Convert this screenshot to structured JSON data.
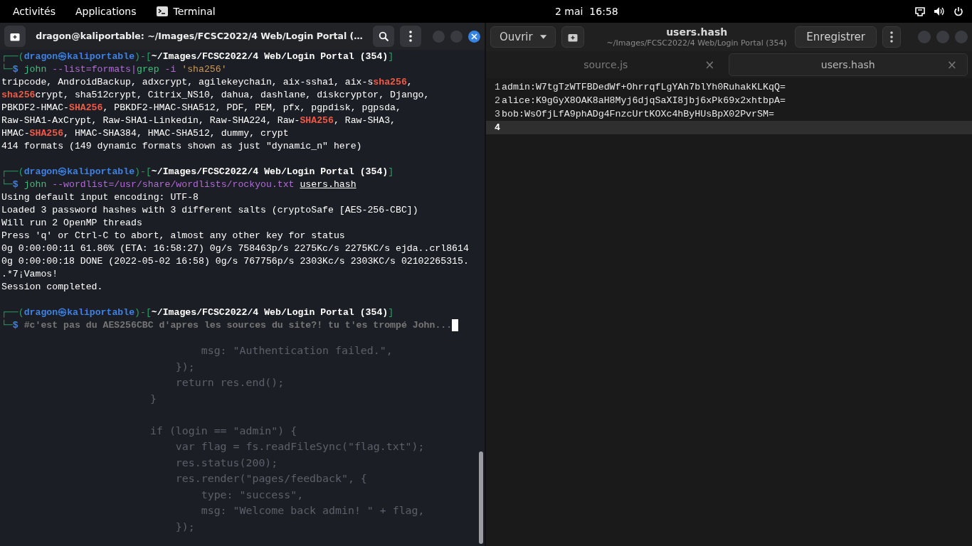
{
  "top_bar": {
    "activities": "Activités",
    "applications": "Applications",
    "app_name": "Terminal",
    "clock": "2 mai  16:58"
  },
  "terminal": {
    "title": "dragon@kaliportable: ~/Images/FCSC2022/4 Web/Login Portal (…",
    "cursor_visible": true,
    "blocks": [
      {
        "kind": "prompt",
        "frame_open": "┌──(",
        "user": "dragon㉿kaliportable",
        "frame_mid": ")-[",
        "path": "~/Images/FCSC2022/4 Web/Login Portal (354)",
        "frame_close": "]",
        "frame_bottom": "└─",
        "symbol": "$",
        "command": [
          {
            "text": "john",
            "kind": "cmd"
          },
          {
            "text": " --list=formats",
            "kind": "opt"
          },
          {
            "text": "|",
            "kind": "opt"
          },
          {
            "text": "grep",
            "kind": "cmd"
          },
          {
            "text": " -i ",
            "kind": "opt"
          },
          {
            "text": "'sha256'",
            "kind": "str"
          }
        ]
      },
      {
        "kind": "output",
        "lines": [
          [
            {
              "text": "tripcode, AndroidBackup, adxcrypt, agilekeychain, aix-ssha1, aix-s",
              "kind": "plain"
            },
            {
              "text": "sha256",
              "kind": "hl"
            },
            {
              "text": ",",
              "kind": "plain"
            }
          ],
          [
            {
              "text": "sha256",
              "kind": "hl"
            },
            {
              "text": "crypt, sha512crypt, Citrix_NS10, dahua, dashlane, diskcryptor, Django,",
              "kind": "plain"
            }
          ],
          [
            {
              "text": "PBKDF2-HMAC-",
              "kind": "plain"
            },
            {
              "text": "SHA256",
              "kind": "hl"
            },
            {
              "text": ", PBKDF2-HMAC-SHA512, PDF, PEM, pfx, pgpdisk, pgpsda,",
              "kind": "plain"
            }
          ],
          [
            {
              "text": "Raw-SHA1-AxCrypt, Raw-SHA1-Linkedin, Raw-SHA224, Raw-",
              "kind": "plain"
            },
            {
              "text": "SHA256",
              "kind": "hl"
            },
            {
              "text": ", Raw-SHA3,",
              "kind": "plain"
            }
          ],
          [
            {
              "text": "HMAC-",
              "kind": "plain"
            },
            {
              "text": "SHA256",
              "kind": "hl"
            },
            {
              "text": ", HMAC-SHA384, HMAC-SHA512, dummy, crypt",
              "kind": "plain"
            }
          ],
          [
            {
              "text": "414 formats (149 dynamic formats shown as just \"dynamic_n\" here)",
              "kind": "plain"
            }
          ]
        ]
      },
      {
        "kind": "blank"
      },
      {
        "kind": "prompt",
        "frame_open": "┌──(",
        "user": "dragon㉿kaliportable",
        "frame_mid": ")-[",
        "path": "~/Images/FCSC2022/4 Web/Login Portal (354)",
        "frame_close": "]",
        "frame_bottom": "└─",
        "symbol": "$",
        "command": [
          {
            "text": "john",
            "kind": "cmd"
          },
          {
            "text": " --wordlist=/usr/share/wordlists/rockyou.txt ",
            "kind": "opt"
          },
          {
            "text": "users.hash",
            "kind": "path"
          }
        ]
      },
      {
        "kind": "output",
        "lines": [
          [
            {
              "text": "Using default input encoding: UTF-8",
              "kind": "plain"
            }
          ],
          [
            {
              "text": "Loaded 3 password hashes with 3 different salts (cryptoSafe [AES-256-CBC])",
              "kind": "plain"
            }
          ],
          [
            {
              "text": "Will run 2 OpenMP threads",
              "kind": "plain"
            }
          ],
          [
            {
              "text": "Press 'q' or Ctrl-C to abort, almost any other key for status",
              "kind": "plain"
            }
          ],
          [
            {
              "text": "0g 0:00:00:11 61.86% (ETA: 16:58:27) 0g/s 758463p/s 2275Kc/s 2275KC/s ejda..crl8614",
              "kind": "plain"
            }
          ],
          [
            {
              "text": "0g 0:00:00:18 DONE (2022-05-02 16:58) 0g/s 767756p/s 2303Kc/s 2303KC/s 02102265315.",
              "kind": "plain"
            }
          ],
          [
            {
              "text": ".*7¡Vamos!",
              "kind": "plain"
            }
          ],
          [
            {
              "text": "Session completed.",
              "kind": "plain"
            }
          ]
        ]
      },
      {
        "kind": "blank"
      },
      {
        "kind": "prompt",
        "frame_open": "┌──(",
        "user": "dragon㉿kaliportable",
        "frame_mid": ")-[",
        "path": "~/Images/FCSC2022/4 Web/Login Portal (354)",
        "frame_close": "]",
        "frame_bottom": "└─",
        "symbol": "$",
        "command": [
          {
            "text": "#c'est pas du AES256CBC d'apres les sources du site?! tu t'es trompé John...",
            "kind": "comment"
          }
        ]
      }
    ],
    "background_code": [
      {
        "kind": "code",
        "text": "        msg: \"Authentication failed.\","
      },
      {
        "kind": "code",
        "text": "    });"
      },
      {
        "kind": "code",
        "text": "    return res.end();"
      },
      {
        "kind": "code",
        "text": "}"
      },
      {
        "kind": "blank"
      },
      {
        "kind": "code",
        "text": "if (login == \"admin\") {"
      },
      {
        "kind": "code",
        "text": "    var flag = fs.readFileSync(\"flag.txt\");"
      },
      {
        "kind": "code",
        "text": "    res.status(200);"
      },
      {
        "kind": "code",
        "text": "    res.render(\"pages/feedback\", {"
      },
      {
        "kind": "code",
        "text": "        type: \"success\","
      },
      {
        "kind": "code",
        "text": "        msg: \"Welcome back admin! \" + flag,"
      },
      {
        "kind": "code",
        "text": "    });"
      }
    ]
  },
  "editor": {
    "open_button": "Ouvrir",
    "title": "users.hash",
    "subtitle": "~/Images/FCSC2022/4 Web/Login Portal (354)",
    "save_button": "Enregistrer",
    "tabs": [
      {
        "label": "source.js",
        "close": "×",
        "selected": false
      },
      {
        "label": "users.hash",
        "close": "×",
        "selected": true
      }
    ],
    "lines": [
      {
        "number": "1",
        "text": "admin:W7tgTzWTFBDedWf+OhrrqfLgYAh7blYh0RuhakKLKqQ=",
        "current": false
      },
      {
        "number": "2",
        "text": "alice:K9gGyX8OAK8aH8Myj6djqSaXI8jbj6xPk69x2xhtbpA=",
        "current": false
      },
      {
        "number": "3",
        "text": "bob:WsOfjLfA9phADg4FnzcUrtKOXc4hByHUsBpX02PvrSM=",
        "current": false
      },
      {
        "number": "4",
        "current": true
      }
    ]
  }
}
